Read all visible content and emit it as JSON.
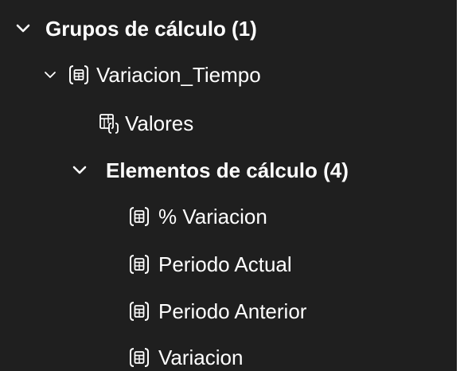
{
  "tree": {
    "root": {
      "label": "Grupos de cálculo (1)",
      "icon": "chevron-down-icon",
      "expanded": true
    },
    "group": {
      "label": "Variacion_Tiempo",
      "icon": "calculation-group-icon",
      "expanded": true
    },
    "column": {
      "label": "Valores",
      "icon": "table-column-icon"
    },
    "items_folder": {
      "label": "Elementos de cálculo (4)",
      "expanded": true
    },
    "items": [
      {
        "label": "% Variacion",
        "icon": "calculation-item-icon"
      },
      {
        "label": "Periodo Actual",
        "icon": "calculation-item-icon"
      },
      {
        "label": "Periodo Anterior",
        "icon": "calculation-item-icon"
      },
      {
        "label": "Variacion",
        "icon": "calculation-item-icon"
      }
    ]
  },
  "colors": {
    "background": "#1f1f1f",
    "text": "#ffffff"
  }
}
